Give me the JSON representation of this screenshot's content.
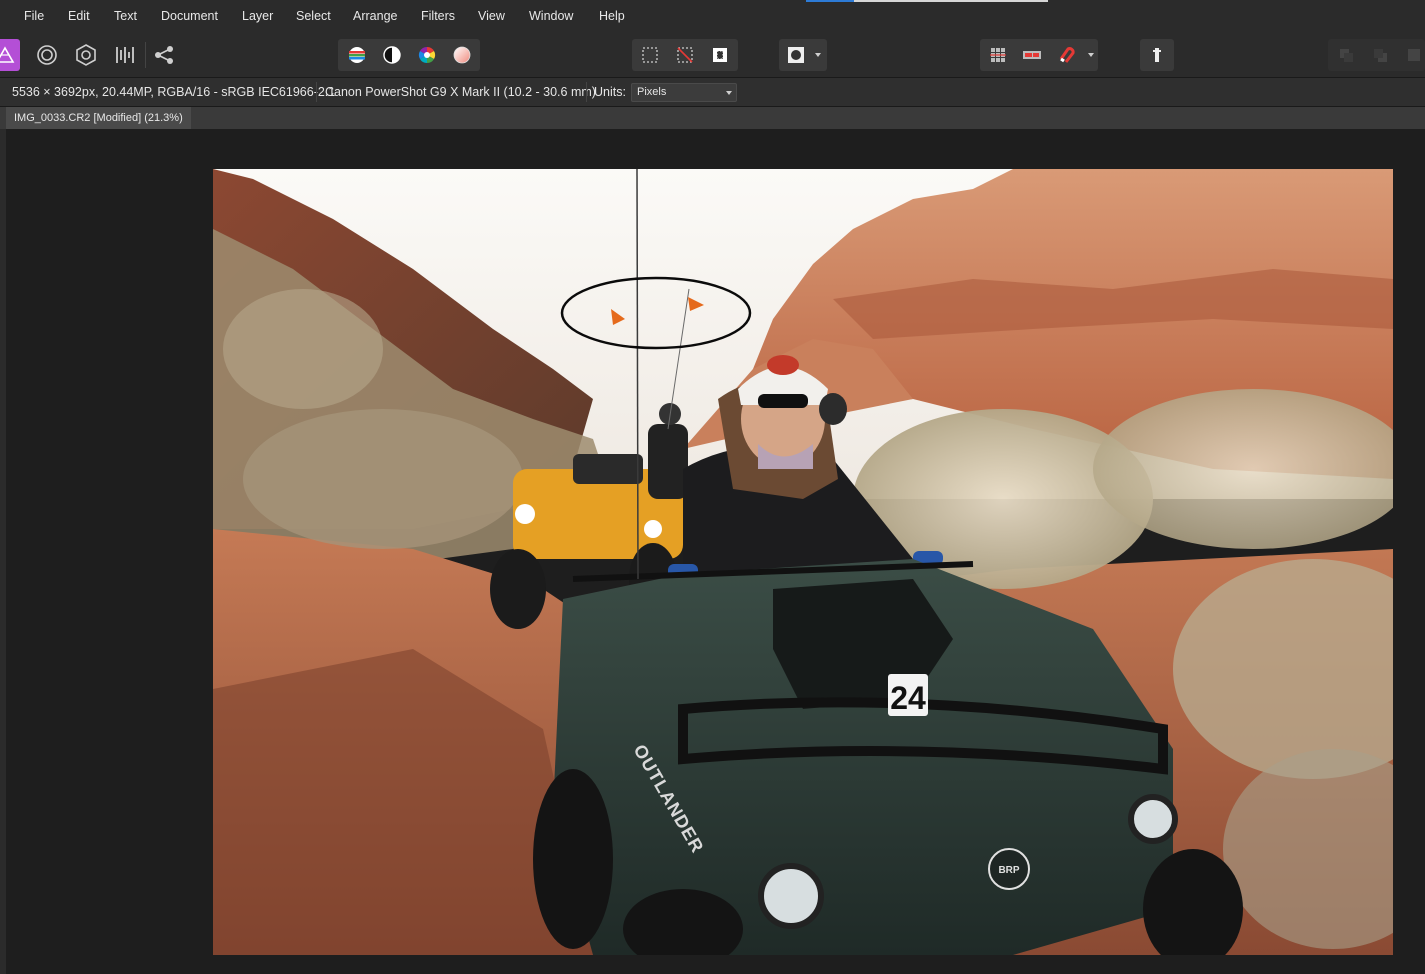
{
  "menu": [
    "File",
    "Edit",
    "Text",
    "Document",
    "Layer",
    "Select",
    "Arrange",
    "Filters",
    "View",
    "Window",
    "Help"
  ],
  "toolbar": {
    "persona_icons": [
      "photo-persona-icon",
      "liquify-persona-icon",
      "develop-persona-icon",
      "tone-mapping-persona-icon",
      "export-persona-icon"
    ],
    "adjust_icons": [
      "auto-levels-icon",
      "auto-contrast-icon",
      "auto-colors-icon",
      "auto-white-balance-icon"
    ],
    "selection_icons": [
      "marquee-select-icon",
      "deselect-icon",
      "invert-selection-icon"
    ],
    "mask_icons": [
      "quick-mask-icon",
      "quick-mask-dropdown-icon"
    ],
    "snapping_icons": [
      "grid-icon",
      "assistant-icon",
      "snapping-magnet-icon",
      "snapping-dropdown-icon"
    ],
    "misc_icons": [
      "context-help-icon"
    ]
  },
  "context": {
    "doc_info": "5536 × 3692px, 20.44MP, RGBA/16 - sRGB IEC61966-2.1",
    "camera": "Canon PowerShot G9 X Mark II (10.2 - 30.6 mm)",
    "units_label": "Units:",
    "units_value": "Pixels"
  },
  "document": {
    "tab_title": "IMG_0033.CR2 [Modified] (21.3%)"
  },
  "photo": {
    "quad_number": "24",
    "brand_text": "OUTLANDER",
    "logo_text": "BRP"
  },
  "colors": {
    "app_bg": "#2b2b2b",
    "canvas_bg": "#1e1e1e",
    "persona_accent": "#b44fd6",
    "sky": "#f4f3f0",
    "rock": "#c6714a",
    "sand": "#b86a48",
    "quad_green": "#2c3a35",
    "quad_orange": "#e5a024"
  }
}
